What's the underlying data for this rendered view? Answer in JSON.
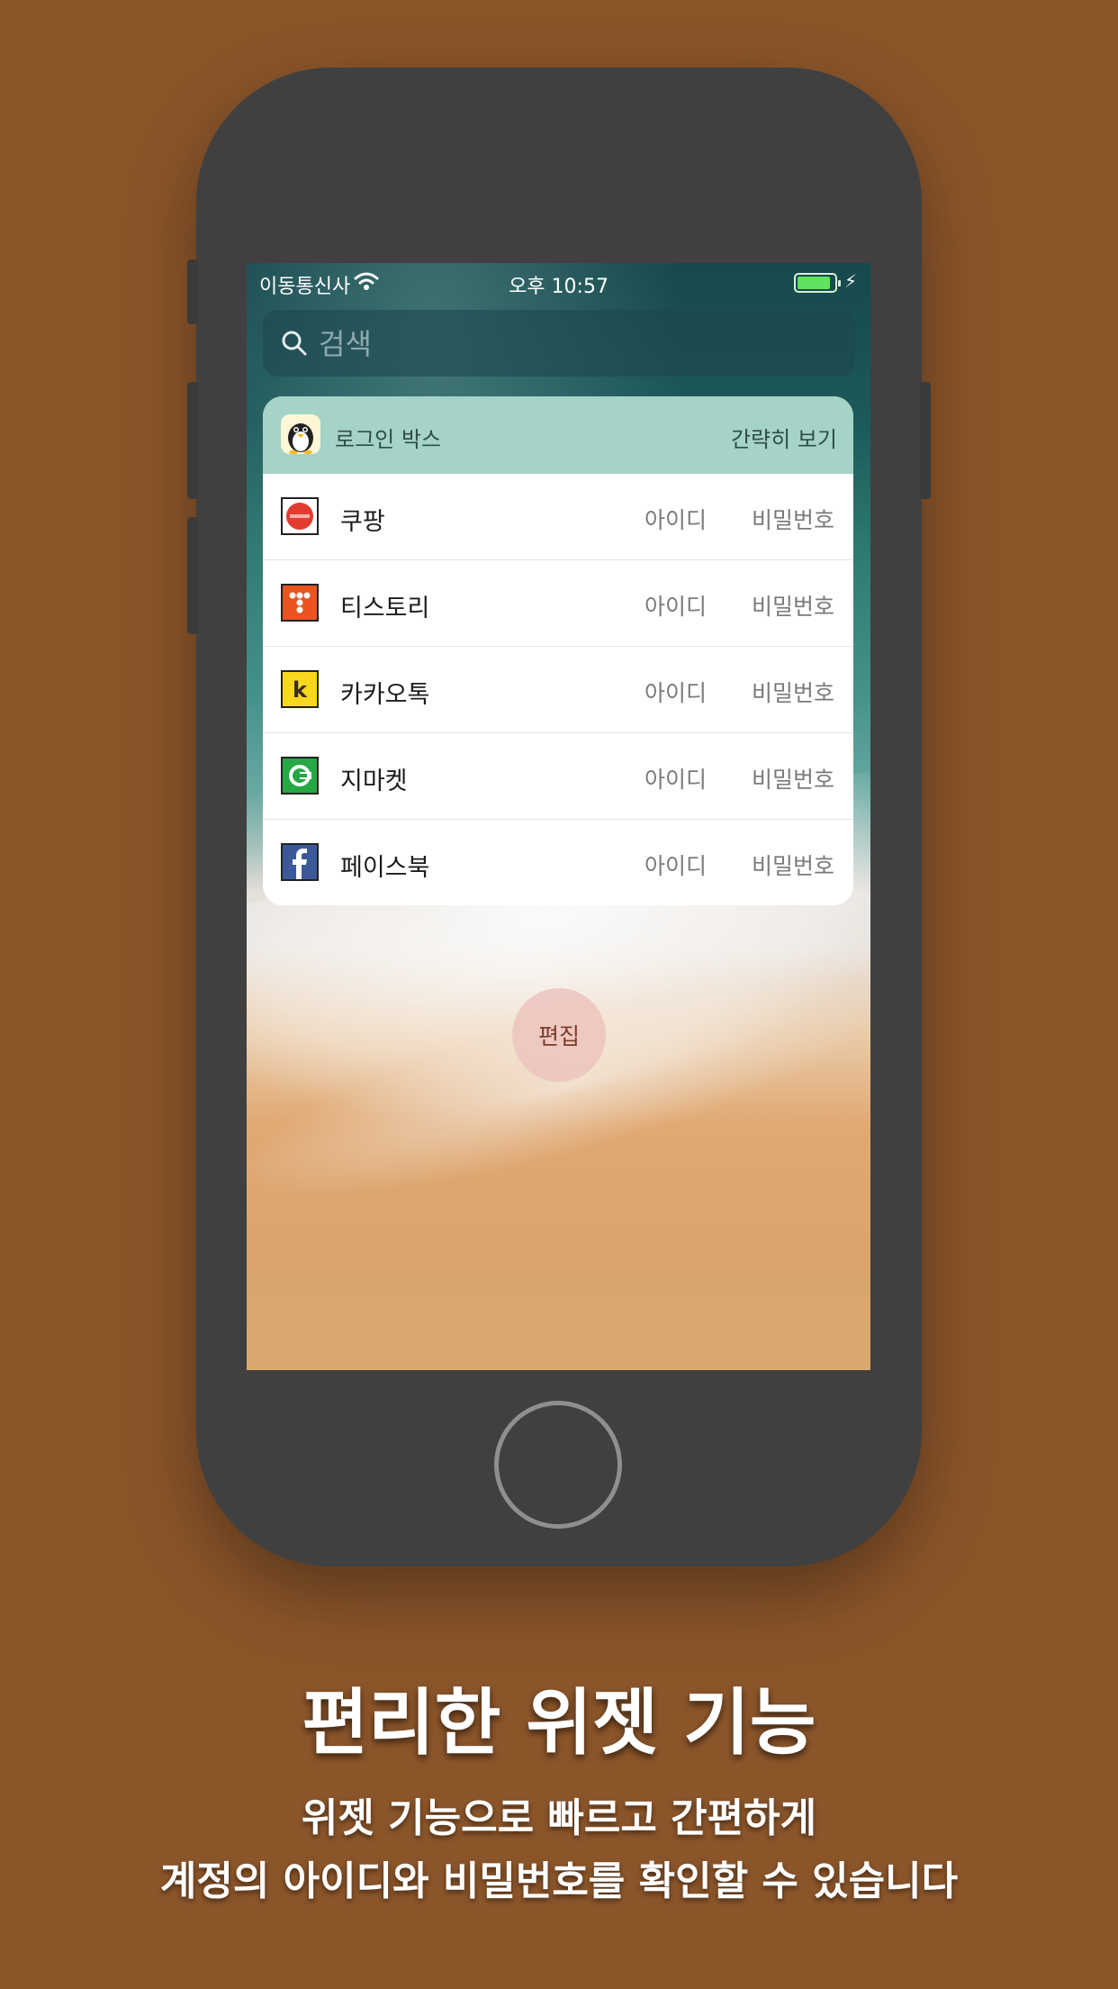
{
  "status_bar": {
    "carrier": "이동통신사",
    "time": "오후 10:57"
  },
  "search": {
    "placeholder": "검색"
  },
  "widget": {
    "title": "로그인 박스",
    "toggle_label": "간략히 보기",
    "rows": [
      {
        "name": "쿠팡",
        "icon": "coupang-icon",
        "id_label": "아이디",
        "pw_label": "비밀번호"
      },
      {
        "name": "티스토리",
        "icon": "tistory-icon",
        "id_label": "아이디",
        "pw_label": "비밀번호"
      },
      {
        "name": "카카오톡",
        "icon": "kakaotalk-icon",
        "id_label": "아이디",
        "pw_label": "비밀번호"
      },
      {
        "name": "지마켓",
        "icon": "gmarket-icon",
        "id_label": "아이디",
        "pw_label": "비밀번호"
      },
      {
        "name": "페이스북",
        "icon": "facebook-icon",
        "id_label": "아이디",
        "pw_label": "비밀번호"
      }
    ]
  },
  "edit_button": {
    "label": "편집"
  },
  "promo": {
    "headline": "편리한 위젯 기능",
    "line1": "위젯 기능으로 빠르고 간편하게",
    "line2": "계정의 아이디와 비밀번호를 확인할 수 있습니다"
  },
  "colors": {
    "background": "#8b552a",
    "phone": "#404040",
    "widget_header": "#a5d3c7"
  }
}
